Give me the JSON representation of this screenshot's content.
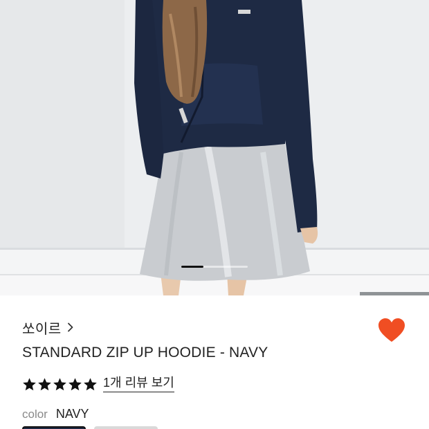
{
  "product": {
    "brand": "쏘이르",
    "title": "STANDARD ZIP UP HOODIE - NAVY",
    "rating": 5,
    "rating_max": 5,
    "review_link": "1개 리뷰 보기",
    "color_label": "color",
    "color_value": "NAVY",
    "wishlisted": true
  },
  "carousel": {
    "current": 1,
    "total": 3
  },
  "colors": {
    "heart": "#f04e23",
    "star": "#111111",
    "hoodie": "#1e2a44"
  },
  "icons": {
    "brand_chevron": "chevron-right-icon",
    "wishlist": "heart-icon",
    "rating": "star-icon"
  }
}
